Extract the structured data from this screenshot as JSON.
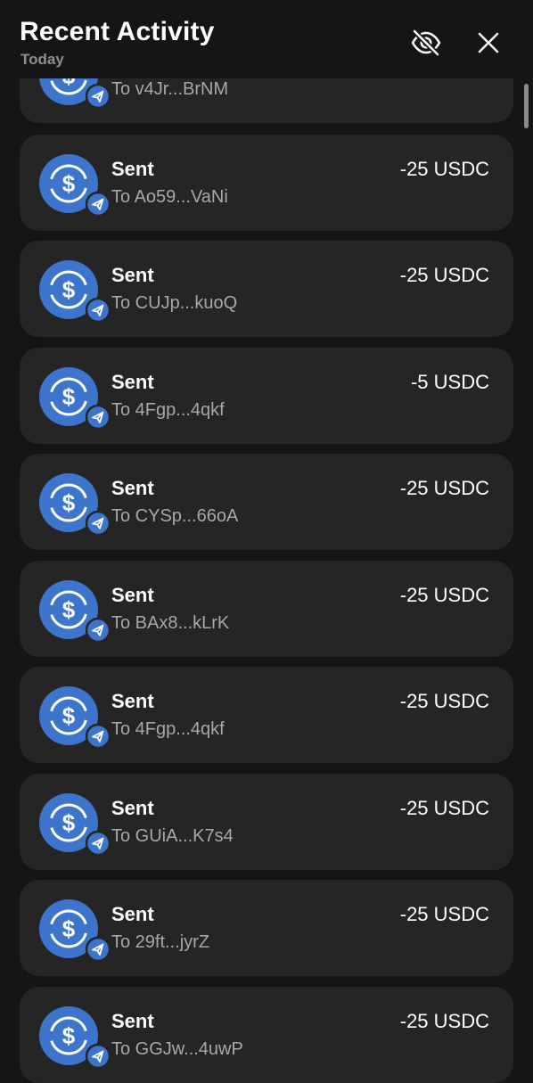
{
  "header": {
    "title": "Recent Activity",
    "subtitle": "Today",
    "hide_icon": "eye-off-icon",
    "close_icon": "close-icon"
  },
  "colors": {
    "background": "#151515",
    "card": "#252525",
    "usdc_blue": "#3d74cc",
    "secondary_text": "#a8a8a8"
  },
  "activity": [
    {
      "label": "",
      "address": "To v4Jr...BrNM",
      "amount": ""
    },
    {
      "label": "Sent",
      "address": "To Ao59...VaNi",
      "amount": "-25 USDC"
    },
    {
      "label": "Sent",
      "address": "To CUJp...kuoQ",
      "amount": "-25 USDC"
    },
    {
      "label": "Sent",
      "address": "To 4Fgp...4qkf",
      "amount": "-5 USDC"
    },
    {
      "label": "Sent",
      "address": "To CYSp...66oA",
      "amount": "-25 USDC"
    },
    {
      "label": "Sent",
      "address": "To BAx8...kLrK",
      "amount": "-25 USDC"
    },
    {
      "label": "Sent",
      "address": "To 4Fgp...4qkf",
      "amount": "-25 USDC"
    },
    {
      "label": "Sent",
      "address": "To GUiA...K7s4",
      "amount": "-25 USDC"
    },
    {
      "label": "Sent",
      "address": "To 29ft...jyrZ",
      "amount": "-25 USDC"
    },
    {
      "label": "Sent",
      "address": "To GGJw...4uwP",
      "amount": "-25 USDC"
    }
  ]
}
